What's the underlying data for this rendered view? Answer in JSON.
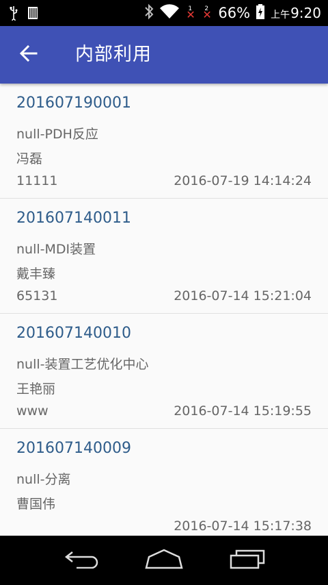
{
  "status_bar": {
    "battery": "66%",
    "time_period": "上午",
    "time": "9:20",
    "sim1": "1",
    "sim2": "2"
  },
  "app_bar": {
    "title": "内部利用"
  },
  "items": [
    {
      "code": "201607190001",
      "dept": "null-PDH反应",
      "person": "冯磊",
      "note": "11111",
      "stamp": "2016-07-19 14:14:24"
    },
    {
      "code": "201607140011",
      "dept": "null-MDI装置",
      "person": "戴丰臻",
      "note": "65131",
      "stamp": "2016-07-14 15:21:04"
    },
    {
      "code": "201607140010",
      "dept": "null-装置工艺优化中心",
      "person": "王艳丽",
      "note": "www",
      "stamp": "2016-07-14 15:19:55"
    },
    {
      "code": "201607140009",
      "dept": "null-分离",
      "person": "曹国伟",
      "note": "",
      "stamp": "2016-07-14 15:17:38"
    }
  ],
  "icons": {
    "back": "arrow-left-icon",
    "usb": "usb-icon",
    "sd": "sd-card-icon",
    "bluetooth": "bluetooth-icon",
    "wifi": "wifi-icon",
    "battery": "battery-charging-icon"
  }
}
